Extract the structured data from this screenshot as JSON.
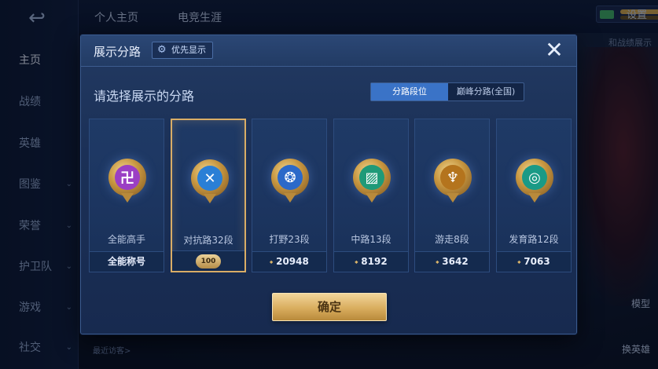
{
  "background": {
    "back_icon": "↩",
    "nav": [
      {
        "label": "主页",
        "active": true,
        "chevron": ""
      },
      {
        "label": "战绩",
        "active": false,
        "chevron": ""
      },
      {
        "label": "英雄",
        "active": false,
        "chevron": ""
      },
      {
        "label": "图鉴",
        "active": false,
        "chevron": "⌄"
      },
      {
        "label": "荣誉",
        "active": false,
        "chevron": "⌄"
      },
      {
        "label": "护卫队",
        "active": false,
        "chevron": "⌄"
      },
      {
        "label": "游戏",
        "active": false,
        "chevron": "⌄"
      },
      {
        "label": "社交",
        "active": false,
        "chevron": "⌄"
      }
    ],
    "tabs": [
      "个人主页",
      "电竞生涯"
    ],
    "settings_label": "设置",
    "hint_text": "和战绩展示",
    "side_buttons": [
      "模型",
      "换英雄"
    ],
    "recent_visitors": "最近访客>"
  },
  "modal": {
    "title": "展示分路",
    "priority_label": "优先显示",
    "close_icon": "✕",
    "subtitle": "请选择展示的分路",
    "segment": {
      "active": "分路段位",
      "inactive": "巅峰分路(全国)"
    },
    "cards": [
      {
        "name": "全能高手",
        "stat": "全能称号",
        "stat_has_icon": false,
        "emblem_color": "#9b3fc4",
        "emblem_glyph": "卍",
        "selected": false,
        "badge": ""
      },
      {
        "name": "对抗路32段",
        "stat": "",
        "stat_has_icon": false,
        "emblem_color": "#2a7fd6",
        "emblem_glyph": "✕",
        "selected": true,
        "badge": "100"
      },
      {
        "name": "打野23段",
        "stat": "20948",
        "stat_has_icon": true,
        "emblem_color": "#2b69c9",
        "emblem_glyph": "❂",
        "selected": false,
        "badge": ""
      },
      {
        "name": "中路13段",
        "stat": "8192",
        "stat_has_icon": true,
        "emblem_color": "#1f9a78",
        "emblem_glyph": "▨",
        "selected": false,
        "badge": ""
      },
      {
        "name": "游走8段",
        "stat": "3642",
        "stat_has_icon": true,
        "emblem_color": "#b4741d",
        "emblem_glyph": "♆",
        "selected": false,
        "badge": ""
      },
      {
        "name": "发育路12段",
        "stat": "7063",
        "stat_has_icon": true,
        "emblem_color": "#1a9a86",
        "emblem_glyph": "◎",
        "selected": false,
        "badge": ""
      }
    ],
    "confirm_label": "确定",
    "points_icon": "⬩"
  }
}
